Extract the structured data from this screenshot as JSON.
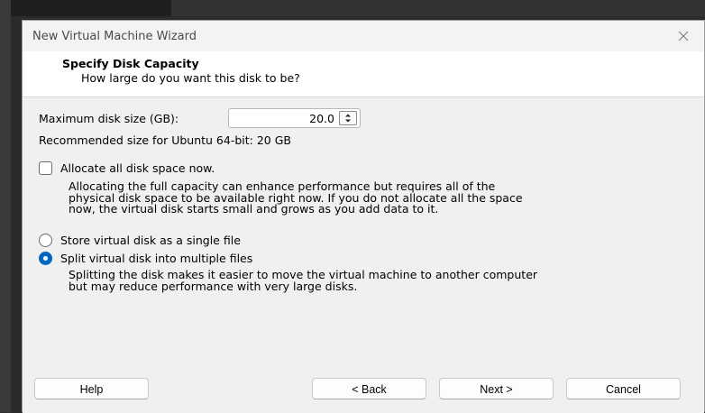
{
  "window": {
    "title": "New Virtual Machine Wizard",
    "close_icon": "close-icon"
  },
  "header": {
    "title": "Specify Disk Capacity",
    "subtitle": "How large do you want this disk to be?"
  },
  "disk_size": {
    "label": "Maximum disk size (GB):",
    "value": "20.0",
    "stepper_icon": "spin-updown-icon",
    "recommended": "Recommended size for Ubuntu 64-bit: 20 GB"
  },
  "allocate": {
    "label": "Allocate all disk space now.",
    "checked": false,
    "desc_lines": [
      "Allocating the full capacity can enhance performance but requires all of the",
      "physical disk space to be available right now. If you do not allocate all the space",
      "now, the virtual disk starts small and grows as you add data to it."
    ]
  },
  "storage": {
    "single_label": "Store virtual disk as a single file",
    "multi_label": "Split virtual disk into multiple files",
    "selected": "multi",
    "multi_desc_lines": [
      "Splitting the disk makes it easier to move the virtual machine to another computer",
      "but may reduce performance with very large disks."
    ]
  },
  "footer": {
    "help": "Help",
    "back": "< Back",
    "next": "Next >",
    "cancel": "Cancel"
  },
  "colors": {
    "accent": "#0067c0",
    "dialog_bg": "#f0f0f0",
    "header_bg": "#ffffff"
  }
}
